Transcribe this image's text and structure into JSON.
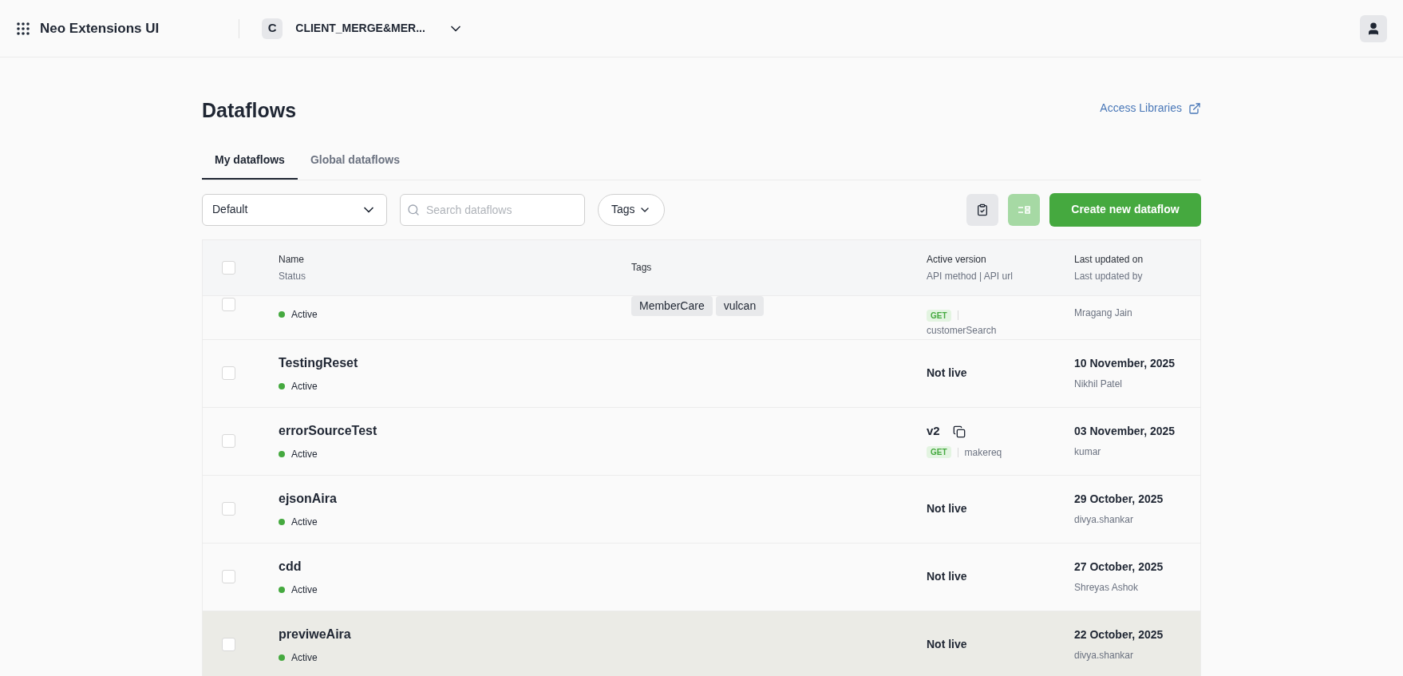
{
  "app": {
    "title": "Neo Extensions UI",
    "org_initial": "C",
    "org_name": "CLIENT_MERGE&MER..."
  },
  "page": {
    "title": "Dataflows",
    "link": "Access Libraries"
  },
  "tabs": [
    {
      "label": "My dataflows",
      "selected": true
    },
    {
      "label": "Global dataflows",
      "selected": false
    }
  ],
  "toolbar": {
    "view": "Default",
    "search_placeholder": "Search dataflows",
    "tags_button": "Tags",
    "create_button": "Create new dataflow"
  },
  "table": {
    "columns": [
      {
        "title": "Name",
        "subtitle": "Status"
      },
      {
        "title": "Tags"
      },
      {
        "title": "Active version",
        "subtitle": "API method | API url"
      },
      {
        "title": "Last updated on",
        "subtitle": "Last updated by"
      }
    ],
    "select_all": {
      "checked": false
    },
    "rows": [
      {
        "status": "Active",
        "tags": [
          "MemberCare",
          "vulcan"
        ],
        "version": {
          "kind": "live",
          "method": "GET",
          "url": "customerSearch"
        },
        "by": "Mragang Jain",
        "checked": false,
        "hovered": false
      },
      {
        "name": "TestingReset",
        "status": "Active",
        "version": {
          "kind": "not_live",
          "label": "Not live"
        },
        "date": "10 November, 2025",
        "by": "Nikhil Patel",
        "checked": false,
        "hovered": false
      },
      {
        "name": "errorSourceTest",
        "status": "Active",
        "version": {
          "kind": "live",
          "label": "v2",
          "method": "GET",
          "url": "makereq"
        },
        "date": "03 November, 2025",
        "by": "kumar",
        "checked": false,
        "hovered": false
      },
      {
        "name": "ejsonAira",
        "status": "Active",
        "version": {
          "kind": "not_live",
          "label": "Not live"
        },
        "date": "29 October, 2025",
        "by": "divya.shankar",
        "checked": false,
        "hovered": false
      },
      {
        "name": "cdd",
        "status": "Active",
        "version": {
          "kind": "not_live",
          "label": "Not live"
        },
        "date": "27 October, 2025",
        "by": "Shreyas Ashok",
        "checked": false,
        "hovered": false
      },
      {
        "name": "previweAira",
        "status": "Active",
        "version": {
          "kind": "not_live",
          "label": "Not live"
        },
        "date": "22 October, 2025",
        "by": "divya.shankar",
        "checked": false,
        "hovered": true
      }
    ]
  }
}
